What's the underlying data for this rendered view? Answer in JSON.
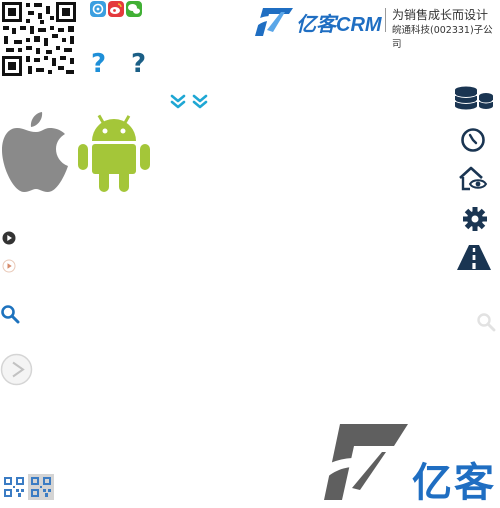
{
  "header": {
    "qr_icon": "qr-code-icon",
    "social_icons": [
      "weibo-tencent-icon",
      "weibo-sina-icon",
      "wechat-icon"
    ],
    "help_marks": [
      "?",
      "?"
    ],
    "help_colors": [
      "#1e8fd8",
      "#1b5f86"
    ],
    "brand": {
      "name": "亿客CRM",
      "tagline": "为销售成长而设计",
      "subsidiary": "皖通科技(002331)子公司"
    }
  },
  "main": {
    "chevron_icon": "double-chevron-down-icon",
    "platform_icons": [
      "apple-icon",
      "android-icon"
    ],
    "play_icons": [
      "play-circle-dark-icon",
      "play-circle-light-icon",
      "play-circle-large-icon"
    ],
    "search_icons": [
      "search-icon-blue",
      "search-icon-gray"
    ]
  },
  "sidebar": {
    "icons": [
      "database-icon",
      "clock-icon",
      "home-eye-icon",
      "gear-icon",
      "road-icon"
    ]
  },
  "footer": {
    "qr_small_icons": [
      "qr-small-icon",
      "qr-small-icon-active"
    ],
    "brand_text": "亿客"
  },
  "colors": {
    "brand_blue": "#1f6ec2",
    "dark_navy": "#1a3552",
    "chevron_cyan": "#1fa7d4",
    "android_green": "#a4c639",
    "apple_gray": "#8a8a8a",
    "logo_gray": "#5f5f5f"
  }
}
